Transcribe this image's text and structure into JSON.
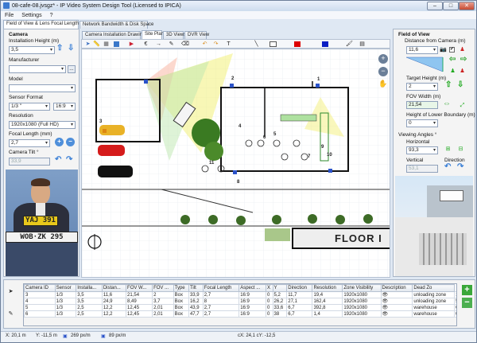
{
  "window": {
    "title": "08-cafe-08.jvsgz* - IP Video System Design Tool (Licensed to IPICA)"
  },
  "menu": {
    "file": "File",
    "settings": "Settings",
    "help": "?"
  },
  "left": {
    "tabs": [
      "Field of View & Lens Focal Length",
      "Network Bandwidth & Disk Space"
    ],
    "camera_header": "Camera",
    "install_height_label": "Installation Height (m)",
    "install_height_value": "3,5",
    "manufacturer_label": "Manufacturer",
    "manufacturer_value": "",
    "browse": "...",
    "model_label": "Model",
    "model_value": "",
    "sensor_label": "Sensor Format",
    "sensor_value": "1/3 \"",
    "aspect_value": "16:9",
    "resolution_label": "Resolution",
    "resolution_value": "1920x1080 (Full HD)",
    "focal_label": "Focal Length (mm)",
    "focal_value": "2,7",
    "tilt_label": "Camera Tilt °",
    "tilt_value": "33,9",
    "preview": {
      "plate_top": "YAJ 391",
      "plate_bottom": "WOB·ZK 295"
    }
  },
  "center": {
    "tabs": [
      "Camera Installation Drawing",
      "Site Plan",
      "3D Views",
      "DVR View"
    ],
    "active_tab": "Site Plan",
    "floor_label": "FLOOR I",
    "camera_numbers": [
      "1",
      "2",
      "3",
      "4",
      "5",
      "6",
      "7",
      "8",
      "9",
      "10",
      "11"
    ],
    "side_tools": [
      "zoom-in",
      "zoom-out",
      "pan"
    ]
  },
  "right": {
    "fov_header": "Field of View",
    "distance_label": "Distance from Camera (m)",
    "distance_value": "11,6",
    "target_height_label": "Target Height (m)",
    "target_height_value": "2",
    "fov_width_label": "FOV Width (m)",
    "fov_width_value": "21,54",
    "lower_boundary_label": "Height of Lower Boundary (m)",
    "lower_boundary_value": "0",
    "viewing_angles_label": "Viewing Angles °",
    "horizontal_label": "Horizontal",
    "horizontal_value": "93,3",
    "vertical_label": "Vertical",
    "vertical_value": "53,1",
    "direction_label": "Direction"
  },
  "table": {
    "columns": [
      "Camera ID",
      "Sensor",
      "Installa...",
      "Distan...",
      "FOV W...",
      "FOV ...",
      "Type",
      "Tilt",
      "Focal Length",
      "Aspect ...",
      "X",
      "Y",
      "Direction",
      "Resolution",
      "Zone Visibility",
      "Description",
      "Dead Zo"
    ],
    "rows": [
      [
        "3",
        "1/3",
        "3,5",
        "11,6",
        "21,54",
        "2",
        "Box",
        "33,9",
        "2,7",
        "16:9",
        "0",
        "5,2",
        "11,7",
        "19,4",
        "1920x1080",
        "👁",
        "unloading zone",
        "1,98"
      ],
      [
        "4",
        "1/3",
        "3,5",
        "24,9",
        "8,49",
        "3,7",
        "Box",
        "16,2",
        "8",
        "16:9",
        "0",
        "26,2",
        "27,1",
        "162,4",
        "1920x1080",
        "👁",
        "unloading zone",
        "5,1"
      ],
      [
        "5",
        "1/3",
        "2,5",
        "12,2",
        "12,45",
        "2,01",
        "Box",
        "43,9",
        "2,7",
        "16:9",
        "0",
        "33,6",
        "6,7",
        "392,8",
        "1920x1080",
        "👁",
        "warehouse",
        "0,19"
      ],
      [
        "6",
        "1/3",
        "2,5",
        "12,2",
        "12,45",
        "2,01",
        "Box",
        "47,7",
        "2,7",
        "16:9",
        "0",
        "38",
        "6,7",
        "1,4",
        "1920x1080",
        "👁",
        "warehouse",
        "0,11"
      ]
    ]
  },
  "status": {
    "x": "X: 20,1 m",
    "y": "Y: -11,5 m",
    "s1": "269 px/m",
    "s2": "89 px/m",
    "c": "cX: 24,1  cY: -12,5"
  }
}
